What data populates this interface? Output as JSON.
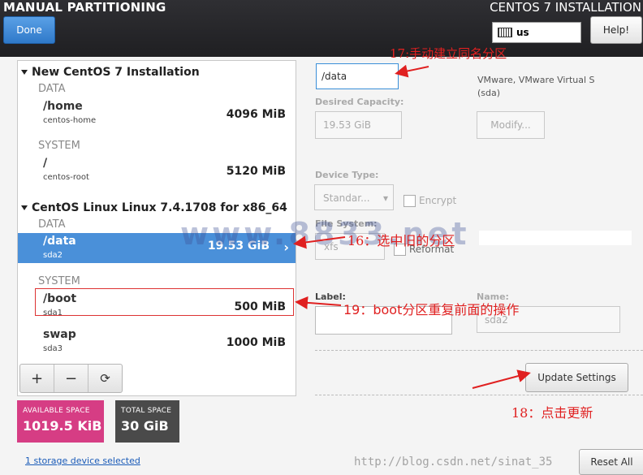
{
  "header": {
    "title": "MANUAL PARTITIONING",
    "product": "CENTOS 7 INSTALLATION",
    "done_label": "Done",
    "keyboard_layout": "us",
    "help_label": "Help!"
  },
  "tree": {
    "groups": [
      {
        "title": "New CentOS 7 Installation",
        "sections": [
          {
            "label": "DATA",
            "items": [
              {
                "mount": "/home",
                "device": "centos-home",
                "size": "4096 MiB"
              }
            ]
          },
          {
            "label": "SYSTEM",
            "items": [
              {
                "mount": "/",
                "device": "centos-root",
                "size": "5120 MiB"
              }
            ]
          }
        ]
      },
      {
        "title": "CentOS Linux Linux 7.4.1708 for x86_64",
        "sections": [
          {
            "label": "DATA",
            "items": [
              {
                "mount": "/data",
                "device": "sda2",
                "size": "19.53 GiB",
                "selected": true
              }
            ]
          },
          {
            "label": "SYSTEM",
            "items": [
              {
                "mount": "/boot",
                "device": "sda1",
                "size": "500 MiB"
              },
              {
                "mount": "swap",
                "device": "sda3",
                "size": "1000 MiB"
              }
            ]
          }
        ]
      }
    ]
  },
  "toolbar": {
    "add": "+",
    "remove": "−",
    "refresh": "⟳"
  },
  "space": {
    "available_label": "AVAILABLE SPACE",
    "available_value": "1019.5 KiB",
    "total_label": "TOTAL SPACE",
    "total_value": "30 GiB"
  },
  "storage_link": "1 storage device selected",
  "details": {
    "mount_point": "/data",
    "desired_capacity_label": "Desired Capacity:",
    "desired_capacity_value": "19.53 GiB",
    "device_info_line1": "VMware, VMware Virtual S",
    "device_info_line2": "(sda)",
    "modify_label": "Modify...",
    "device_type_label": "Device Type:",
    "device_type_value": "Standar...",
    "encrypt_label": "Encrypt",
    "file_system_label": "File System:",
    "file_system_value": "xfs",
    "reformat_label": "Reformat",
    "label_label": "Label:",
    "label_value": "",
    "name_label": "Name:",
    "name_value": "sda2",
    "update_label": "Update Settings",
    "reset_label": "Reset All"
  },
  "annotations": {
    "a17": "17:手动建立同名分区",
    "a16": "16：选中旧的分区",
    "a19": "19：boot分区重复前面的操作",
    "a18": "18：点击更新"
  },
  "watermarks": {
    "site": "www.8833.net",
    "url": "http://blog.csdn.net/sinat_35"
  },
  "colors": {
    "accent": "#4a90d9",
    "available": "#d63d84",
    "total": "#4a4a4a",
    "annotation": "#e02020"
  }
}
